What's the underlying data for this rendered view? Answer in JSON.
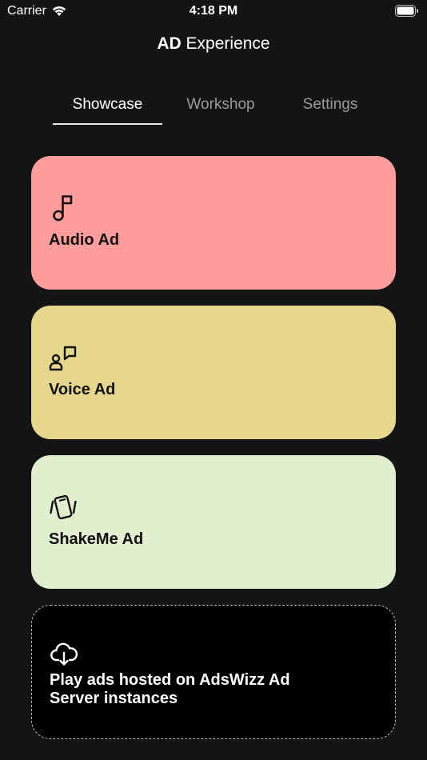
{
  "status_bar": {
    "carrier": "Carrier",
    "time": "4:18 PM"
  },
  "header": {
    "title_bold": "AD",
    "title_rest": " Experience"
  },
  "tabs": [
    {
      "label": "Showcase",
      "selected": true
    },
    {
      "label": "Workshop",
      "selected": false
    },
    {
      "label": "Settings",
      "selected": false
    }
  ],
  "cards": [
    {
      "label": "Audio Ad",
      "icon": "music-note-icon",
      "color": "#ff9d9c"
    },
    {
      "label": "Voice Ad",
      "icon": "voice-speech-icon",
      "color": "#e7d78c"
    },
    {
      "label": "ShakeMe Ad",
      "icon": "shake-phone-icon",
      "color": "#e2efce"
    },
    {
      "label": "Play ads hosted on AdsWizz Ad Server instances",
      "icon": "cloud-download-icon",
      "color": "#000000"
    }
  ],
  "colors": {
    "background": "#141414",
    "tab_active": "#ffffff",
    "tab_inactive": "#9a9a9a"
  }
}
